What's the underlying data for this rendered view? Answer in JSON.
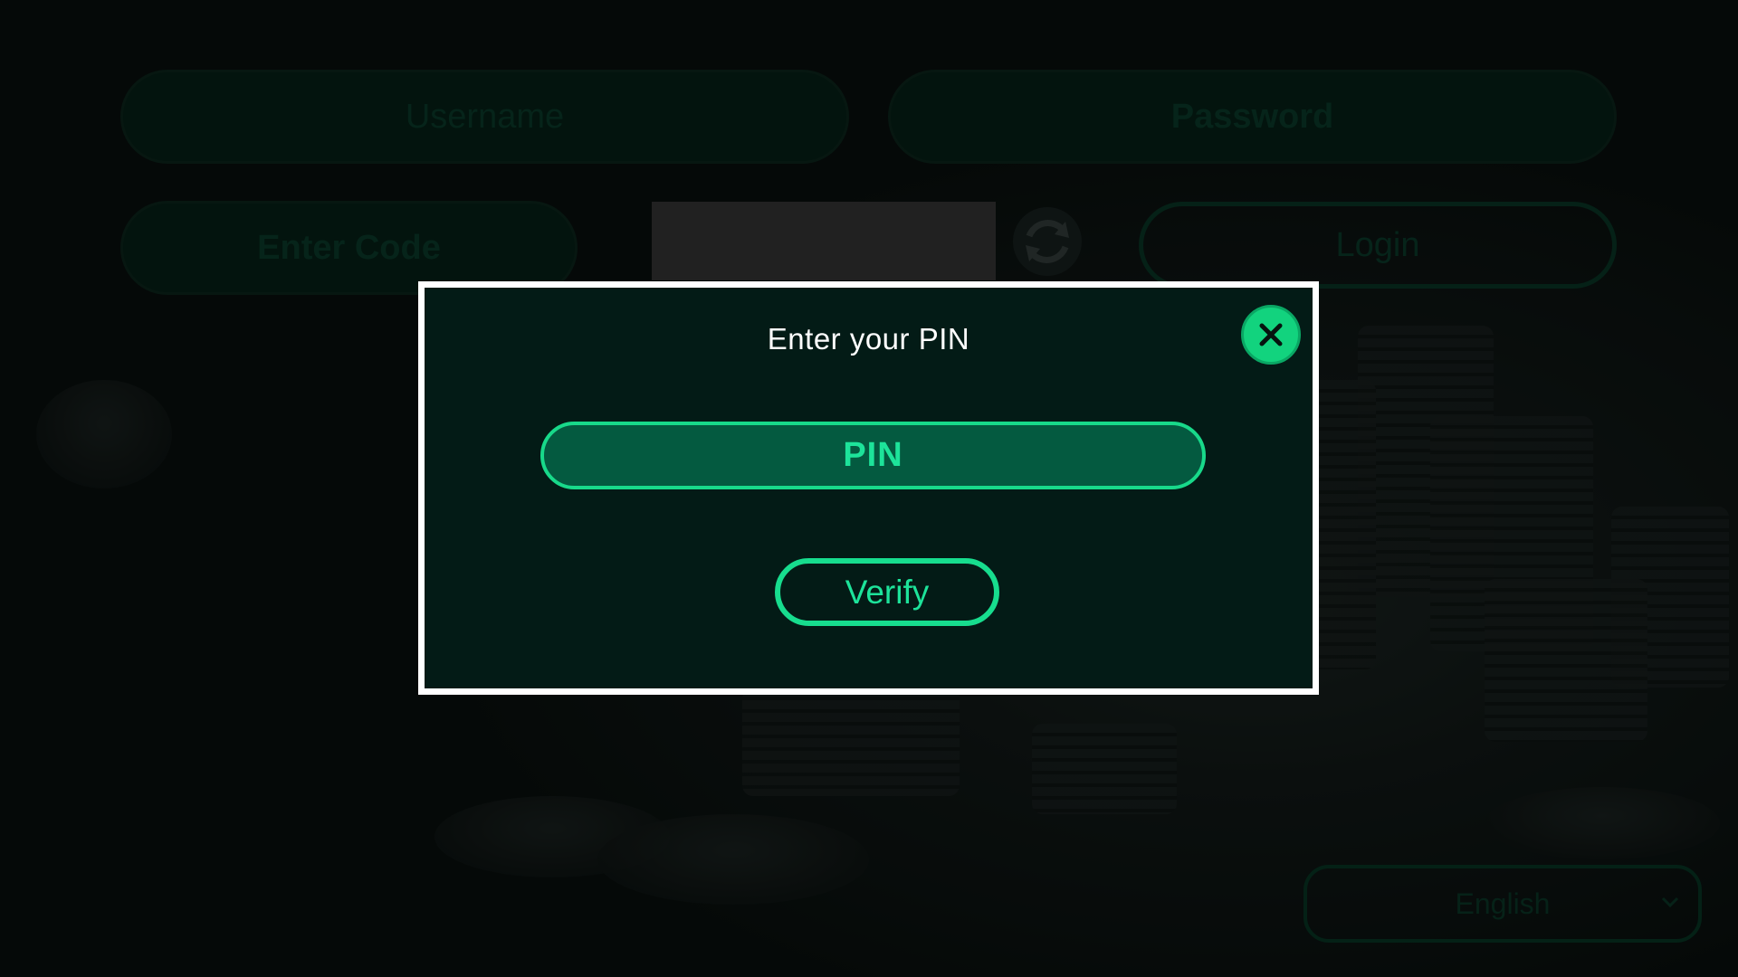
{
  "login_form": {
    "username_placeholder": "Username",
    "password_placeholder": "Password",
    "code_placeholder": "Enter Code",
    "login_label": "Login",
    "refresh_icon": "refresh-icon"
  },
  "language_selector": {
    "selected": "English",
    "icon": "chevron-down-icon"
  },
  "pin_modal": {
    "title": "Enter your PIN",
    "pin_placeholder": "PIN",
    "verify_label": "Verify",
    "close_icon": "close-icon"
  },
  "colors": {
    "accent": "#12d37e",
    "modal_bg": "#031b16",
    "modal_border": "#ffffff",
    "field_fill": "#045a40"
  }
}
